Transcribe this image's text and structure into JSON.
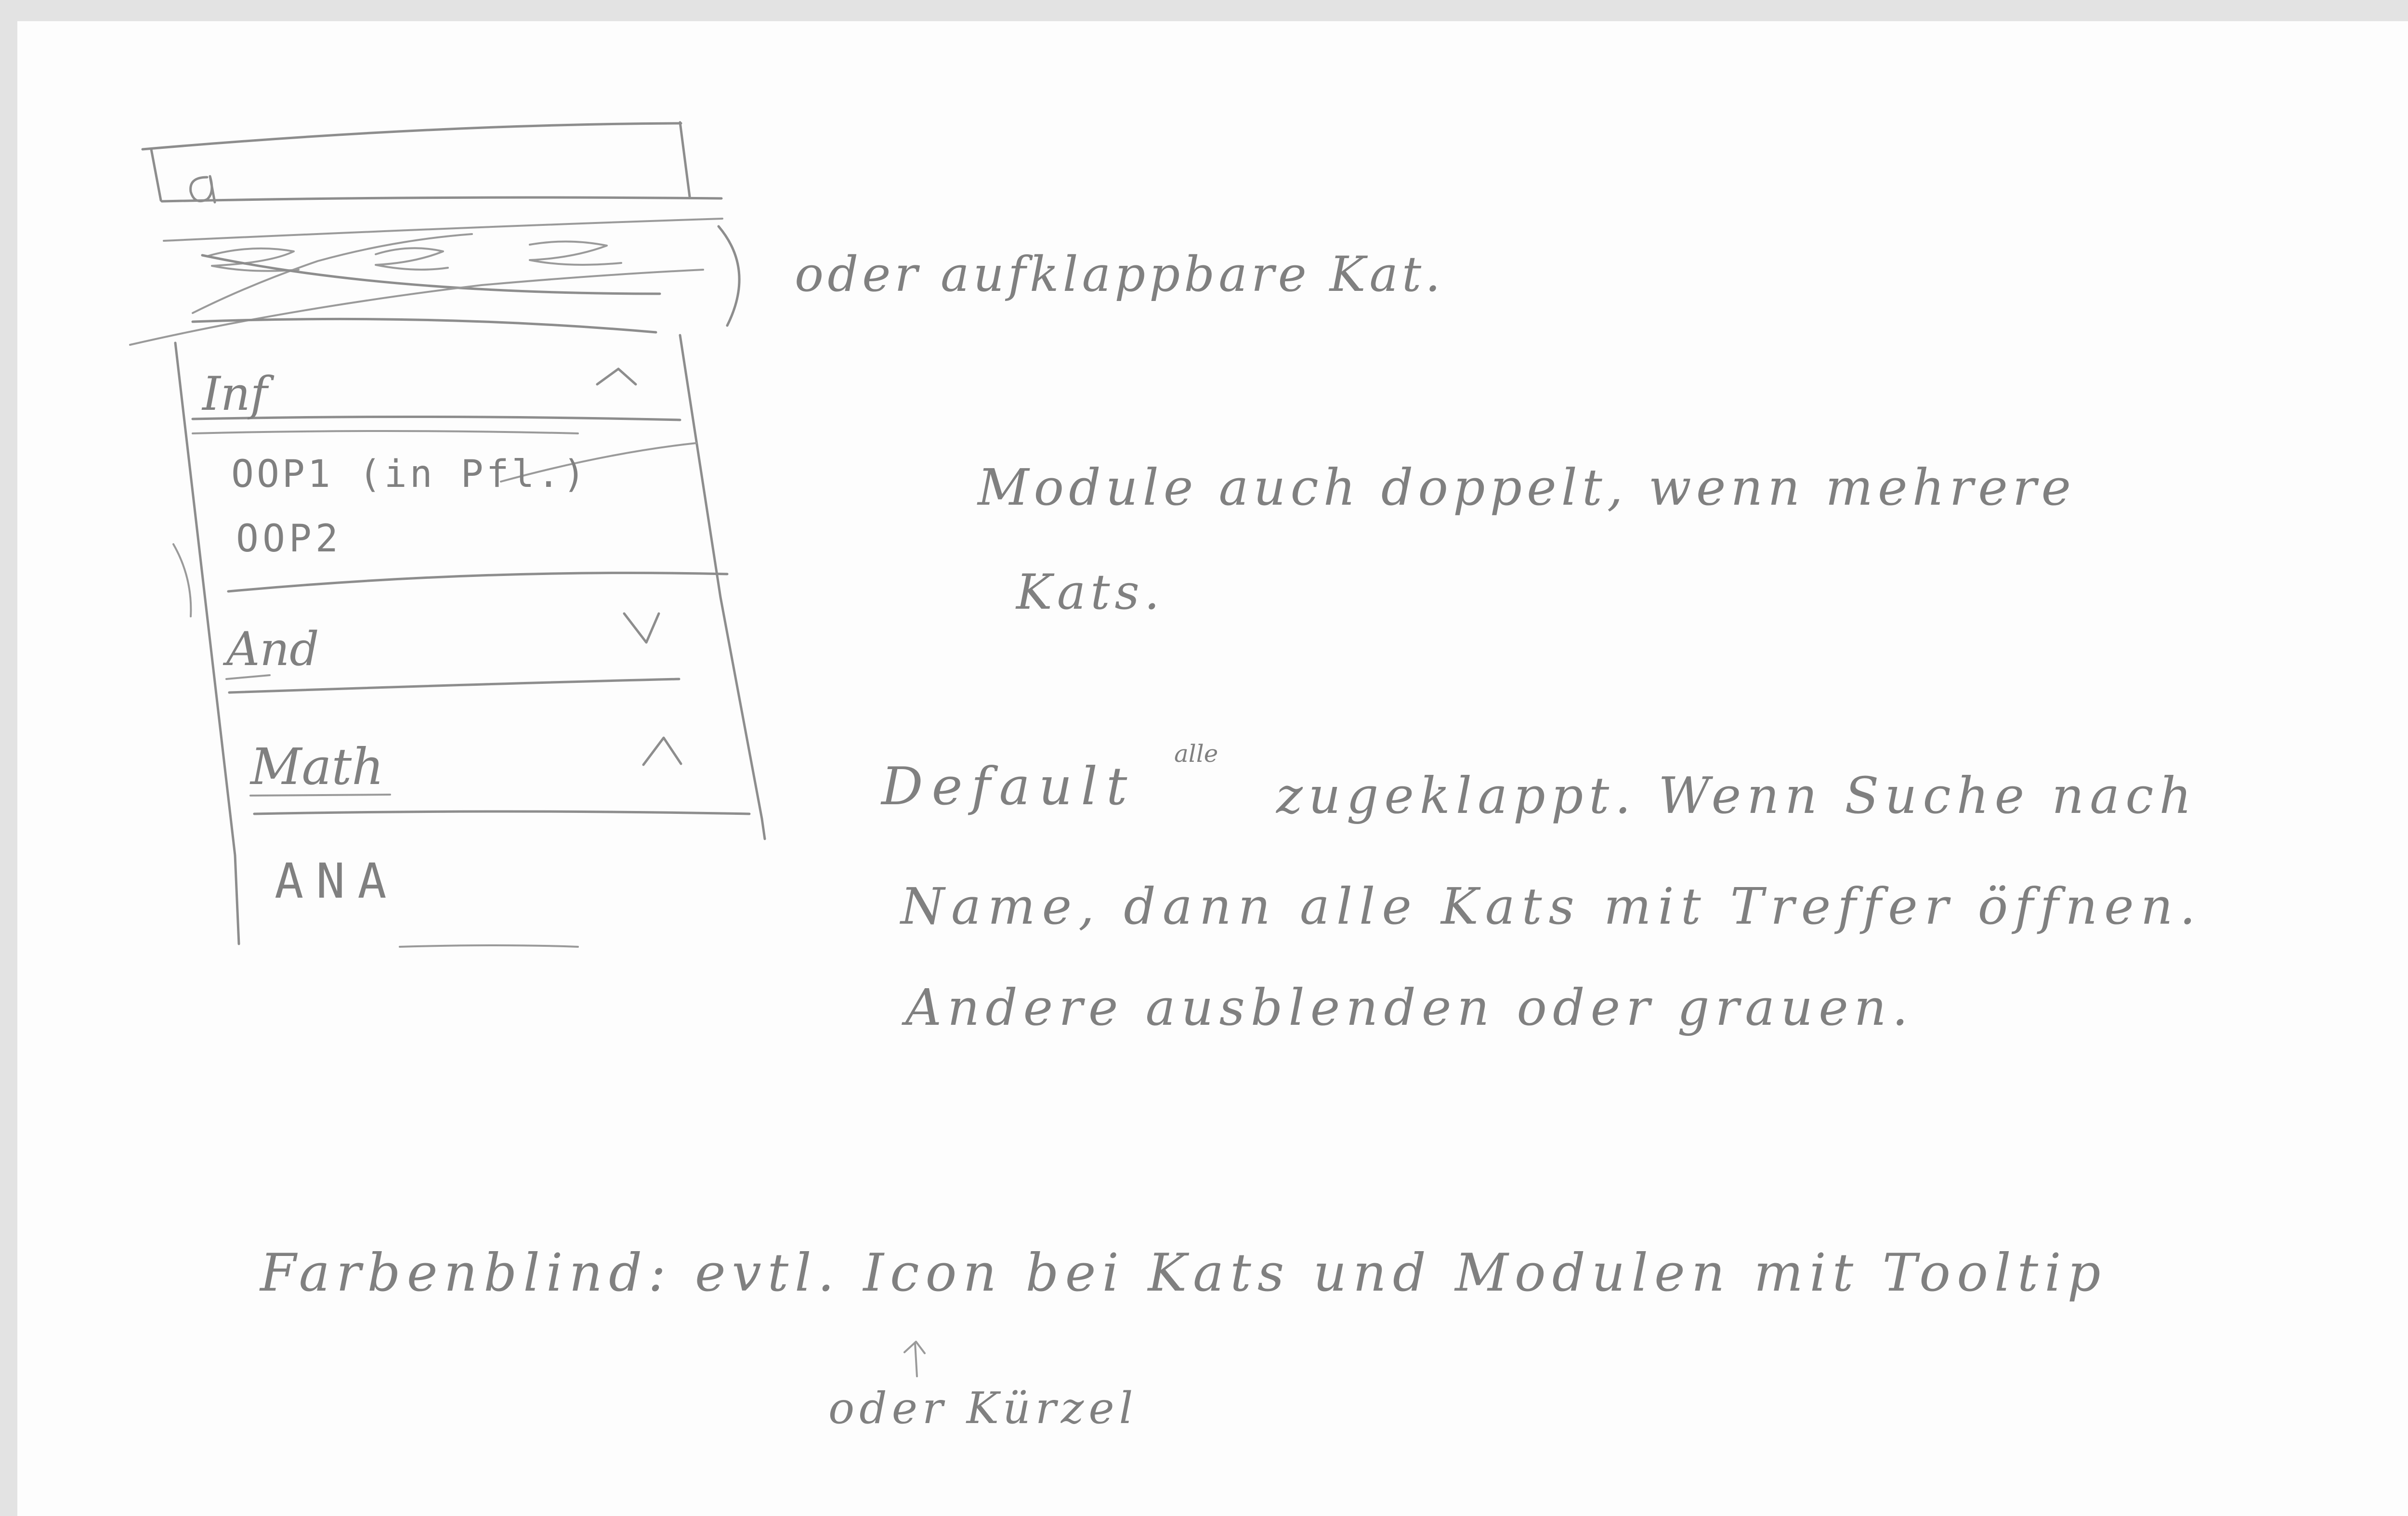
{
  "sketch": {
    "search_glyph": "a",
    "icons": [
      "search-icon",
      "chevron-up-icon",
      "chevron-down-icon",
      "arrow-up-icon"
    ],
    "categories": [
      {
        "label": "Inf",
        "toggle": "^",
        "items": [
          "OOP1 (in Pfl.)",
          "OOP2"
        ],
        "item_strikethrough": true
      },
      {
        "label": "And",
        "toggle": "v",
        "items": []
      },
      {
        "label": "Math",
        "toggle": "^",
        "items": [
          "ANA"
        ]
      }
    ]
  },
  "notes": {
    "collapsible_note": "oder aufklappbare Kat.",
    "modules_line1": "Module auch doppelt, wenn mehrere",
    "modules_line2": "Kats.",
    "default_line1_a": "Default",
    "default_superscript": "alle",
    "default_line1_b": "zugeklappt. Wenn Suche nach",
    "default_line2": "Name, dann alle Kats mit Treffer öffnen.",
    "default_line3": "Andere ausblenden oder grauen.",
    "colorblind_line": "Farbenblind: evtl. Icon bei Kats und Modulen mit Tooltip",
    "colorblind_alt": "oder Kürzel"
  }
}
